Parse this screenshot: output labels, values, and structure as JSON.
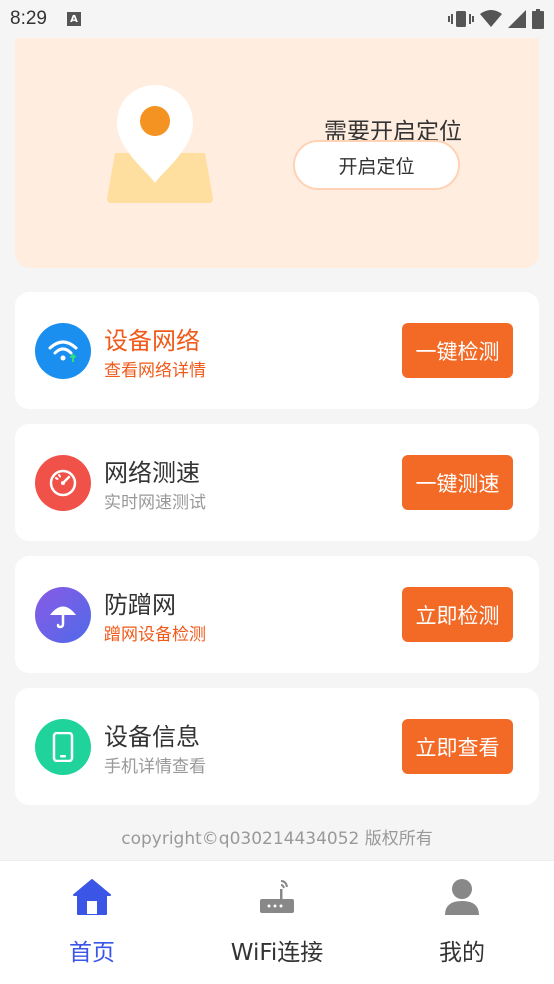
{
  "status_bar": {
    "time": "8:29",
    "notification_icon": "A"
  },
  "location": {
    "prompt": "需要开启定位",
    "button_label": "开启定位"
  },
  "cards": [
    {
      "title": "设备网络",
      "subtitle": "查看网络详情",
      "button": "一键检测",
      "icon": "wifi-icon",
      "icon_color": "#1a8ff0"
    },
    {
      "title": "网络测速",
      "subtitle": "实时网速测试",
      "button": "一键测速",
      "icon": "speedometer-icon",
      "icon_color": "#f0524a"
    },
    {
      "title": "防蹭网",
      "subtitle": "蹭网设备检测",
      "button": "立即检测",
      "icon": "umbrella-icon",
      "icon_color": "#6a5ae0"
    },
    {
      "title": "设备信息",
      "subtitle": "手机详情查看",
      "button": "立即查看",
      "icon": "phone-icon",
      "icon_color": "#1fd39b"
    }
  ],
  "copyright": "copyright©q030214434052 版权所有",
  "nav": {
    "items": [
      {
        "label": "首页",
        "icon": "home-icon",
        "active": true
      },
      {
        "label": "WiFi连接",
        "icon": "router-icon",
        "active": false
      },
      {
        "label": "我的",
        "icon": "profile-icon",
        "active": false
      }
    ]
  },
  "colors": {
    "accent": "#f26a26",
    "nav_active": "#3b55e6",
    "banner_bg": "#ffede0"
  }
}
